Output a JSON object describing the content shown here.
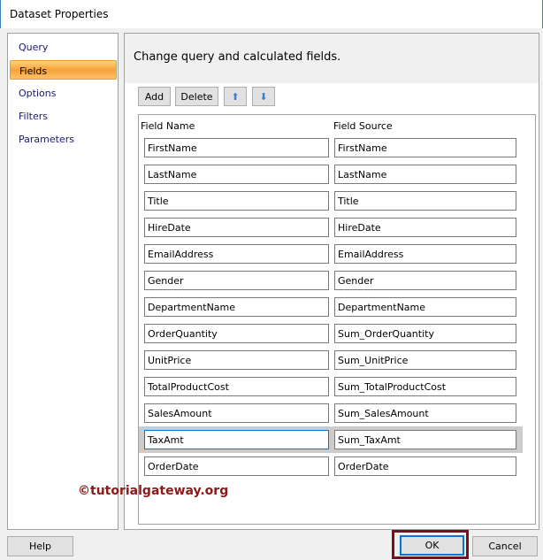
{
  "window": {
    "title": "Dataset Properties"
  },
  "nav": {
    "items": [
      {
        "label": "Query"
      },
      {
        "label": "Fields",
        "selected": true
      },
      {
        "label": "Options"
      },
      {
        "label": "Filters"
      },
      {
        "label": "Parameters"
      }
    ]
  },
  "main": {
    "header": "Change query and calculated fields.",
    "toolbar": {
      "add": "Add",
      "delete": "Delete",
      "up_icon": "arrow-up-icon",
      "down_icon": "arrow-down-icon"
    },
    "columns": {
      "name": "Field Name",
      "source": "Field Source"
    },
    "fields": [
      {
        "name": "FirstName",
        "source": "FirstName"
      },
      {
        "name": "LastName",
        "source": "LastName"
      },
      {
        "name": "Title",
        "source": "Title"
      },
      {
        "name": "HireDate",
        "source": "HireDate"
      },
      {
        "name": "EmailAddress",
        "source": "EmailAddress"
      },
      {
        "name": "Gender",
        "source": "Gender"
      },
      {
        "name": "DepartmentName",
        "source": "DepartmentName"
      },
      {
        "name": "OrderQuantity",
        "source": "Sum_OrderQuantity"
      },
      {
        "name": "UnitPrice",
        "source": "Sum_UnitPrice"
      },
      {
        "name": "TotalProductCost",
        "source": "Sum_TotalProductCost"
      },
      {
        "name": "SalesAmount",
        "source": "Sum_SalesAmount"
      },
      {
        "name": "TaxAmt",
        "source": "Sum_TaxAmt",
        "selected": true
      },
      {
        "name": "OrderDate",
        "source": "OrderDate"
      }
    ]
  },
  "watermark": "©tutorialgateway.org",
  "footer": {
    "help": "Help",
    "ok": "OK",
    "cancel": "Cancel"
  }
}
